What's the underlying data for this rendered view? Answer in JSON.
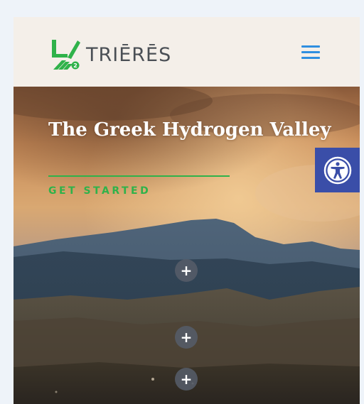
{
  "header": {
    "brand": "TRIĒRĒS",
    "logo_icon": "trieres-logo-icon",
    "menu_icon": "hamburger-menu-icon",
    "brand_color": "#2fb24a",
    "menu_color": "#2f8fe0"
  },
  "hero": {
    "title": "The Greek Hydrogen Valley",
    "cta_label": "GET STARTED",
    "hotspot_label": "+",
    "hotspot_count": 3
  },
  "accessibility": {
    "icon": "accessibility-icon",
    "color": "#3a4ea8"
  }
}
